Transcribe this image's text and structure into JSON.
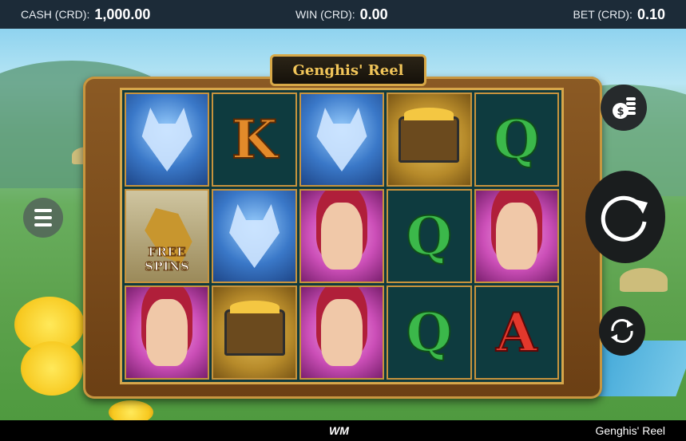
{
  "topbar": {
    "cash_label": "CASH (CRD):",
    "cash_value": "1,000.00",
    "win_label": "WIN (CRD):",
    "win_value": "0.00",
    "bet_label": "BET (CRD):",
    "bet_value": "0.10"
  },
  "game": {
    "title": "Genghis' Reel",
    "free_spins_label": "FREE SPINS"
  },
  "reels": [
    [
      "wolf",
      "horse-free-spins",
      "woman"
    ],
    [
      "K",
      "wolf",
      "chest"
    ],
    [
      "wolf",
      "woman",
      "woman"
    ],
    [
      "chest",
      "Q",
      "Q"
    ],
    [
      "Q",
      "woman",
      "A"
    ]
  ],
  "controls": {
    "menu": "menu-icon",
    "bet": "coins-icon",
    "spin": "spin-arrow-icon",
    "autoplay": "autoplay-icon"
  },
  "footer": {
    "logo": "WM",
    "game_name": "Genghis' Reel"
  },
  "colors": {
    "topbar": "#1c2b38",
    "frame": "#8b5a24",
    "gold": "#d6a64a",
    "reel_bg": "#0e3b3f"
  }
}
